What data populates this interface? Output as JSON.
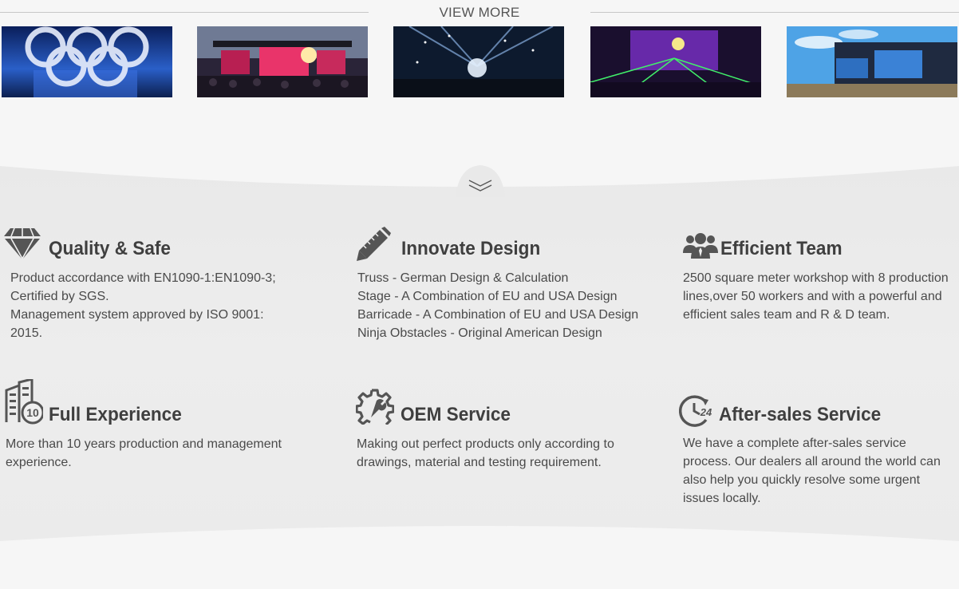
{
  "header": {
    "view_more_label": "VIEW MORE"
  },
  "gallery": {
    "items": [
      {
        "icon": "olympic-rings-stage-photo"
      },
      {
        "icon": "festival-stage-screens-photo"
      },
      {
        "icon": "concert-lights-crowd-photo"
      },
      {
        "icon": "laser-show-stage-photo"
      },
      {
        "icon": "outdoor-stage-truss-photo"
      }
    ]
  },
  "colors": {
    "icon": "#555555",
    "title": "#3f3f3f",
    "text": "#4a4a4a",
    "band": "#eeeeee"
  },
  "features": [
    {
      "icon": "diamond-icon",
      "title": "Quality & Safe",
      "lines": [
        "Product accordance with EN1090-1:EN1090-3;",
        "Certified by SGS.",
        "Management system approved by ISO 9001:",
        "2015."
      ]
    },
    {
      "icon": "pencil-ruler-icon",
      "title": "Innovate Design",
      "lines": [
        "Truss  - German Design & Calculation",
        "Stage  - A Combination of EU and USA Design",
        "Barricade  - A Combination of EU and USA Design",
        "Ninja Obstacles - Original American Design"
      ]
    },
    {
      "icon": "team-people-icon",
      "title": "Efficient Team",
      "lines": [
        "2500 square meter workshop with 8 production",
        "lines,over 50 workers and with a powerful and",
        "efficient sales team and R & D team."
      ]
    },
    {
      "icon": "building-10-years-icon",
      "badge": "10",
      "title": "Full Experience",
      "lines": [
        "More than 10 years production and management",
        "experience."
      ]
    },
    {
      "icon": "gear-wrench-icon",
      "title": "OEM Service",
      "lines": [
        "Making out perfect products only according to",
        "drawings, material and testing requirement."
      ]
    },
    {
      "icon": "clock-24-icon",
      "badge": "24",
      "title": "After-sales Service",
      "lines": [
        "We have a complete after-sales service",
        "process. Our dealers all around the world can",
        "also help you quickly resolve some urgent",
        "issues locally."
      ]
    }
  ]
}
